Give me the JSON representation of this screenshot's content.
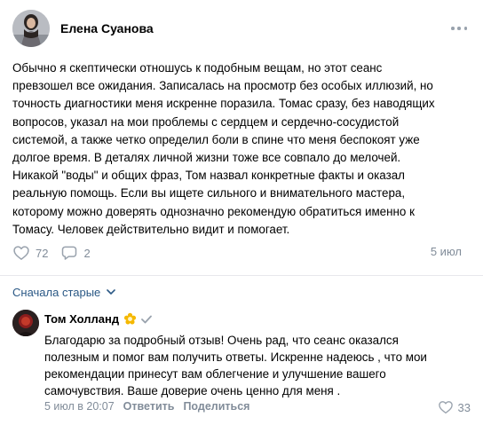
{
  "post": {
    "author": "Елена Суанова",
    "text_lines": [
      "Обычно я скептически отношусь к подобным вещам, но этот сеанс",
      "превзошел все ожидания. Записалась на просмотр без особых иллюзий, но",
      "точность диагностики меня искренне поразила. Томас сразу, без наводящих",
      "вопросов, указал на мои проблемы с сердцем и сердечно-сосудистой",
      "системой, а также четко определил боли в спине что меня беспокоят уже",
      "долгое время. В деталях личной жизни тоже все совпало до мелочей.",
      "Никакой \"воды\" и общих фраз, Том назвал конкретные факты и оказал",
      "реальную помощь. Если вы ищете сильного и внимательного мастера,",
      "которому можно доверять однозначно рекомендую обратиться именно к",
      "Томасу. Человек действительно видит и помогает."
    ],
    "likes": "72",
    "comments": "2",
    "date": "5 июл"
  },
  "sort_label": "Сначала старые",
  "comment": {
    "author": "Том Холланд",
    "text_lines": [
      "Благодарю за подробный отзыв! Очень рад, что сеанс оказался",
      "полезным и помог вам получить ответы. Искренне надеюсь , что мои",
      "рекомендации принесут вам облегчение и улучшение вашего",
      "самочувствия. Ваше доверие очень ценно для меня ."
    ],
    "date": "5 июл в 20:07",
    "reply_label": "Ответить",
    "share_label": "Поделиться",
    "likes": "33"
  },
  "icons": {
    "more": "more-horizontal-icon",
    "like": "heart-icon",
    "comment": "comment-bubble-icon",
    "sort": "chevron-down-icon",
    "badge": "flower-badge-icon",
    "verified": "check-icon"
  },
  "colors": {
    "link": "#2a5885",
    "secondary": "#818c99",
    "divider": "#e7e8ec",
    "badge": "#f5b800"
  }
}
